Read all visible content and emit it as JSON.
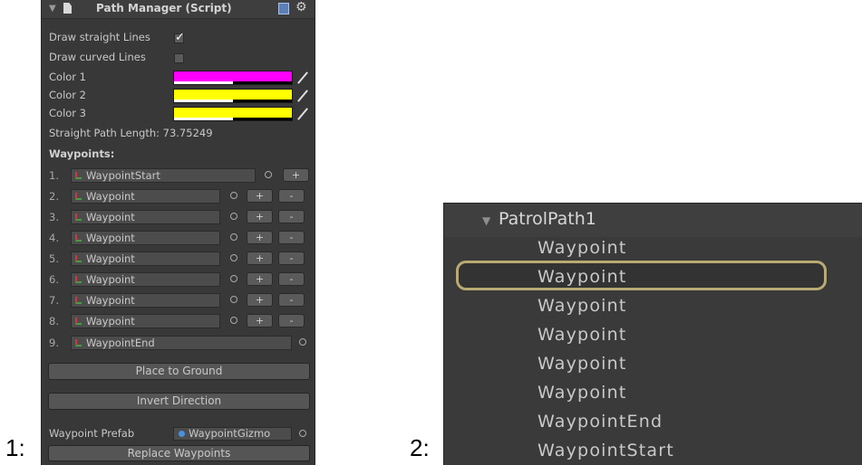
{
  "figure_labels": [
    "1:",
    "2:"
  ],
  "inspector": {
    "header_title": "Path Manager (Script)",
    "rows": {
      "draw_straight_label": "Draw straight Lines",
      "draw_straight_checked": true,
      "draw_curved_label": "Draw curved Lines",
      "draw_curved_checked": false,
      "color1_label": "Color 1",
      "color2_label": "Color 2",
      "color3_label": "Color 3",
      "length_text": "Straight Path Length: 73.75249",
      "waypoints_header": "Waypoints:"
    },
    "colors": {
      "color1": "#ff00ff",
      "color2": "#ffff00",
      "color3": "#ffff00",
      "color_alpha_fraction": 0.5
    },
    "waypoints": [
      {
        "index": "1.",
        "name": "WaypointStart",
        "add": "+"
      },
      {
        "index": "2.",
        "name": "Waypoint",
        "add": "+",
        "remove": "-"
      },
      {
        "index": "3.",
        "name": "Waypoint",
        "add": "+",
        "remove": "-"
      },
      {
        "index": "4.",
        "name": "Waypoint",
        "add": "+",
        "remove": "-"
      },
      {
        "index": "5.",
        "name": "Waypoint",
        "add": "+",
        "remove": "-"
      },
      {
        "index": "6.",
        "name": "Waypoint",
        "add": "+",
        "remove": "-"
      },
      {
        "index": "7.",
        "name": "Waypoint",
        "add": "+",
        "remove": "-"
      },
      {
        "index": "8.",
        "name": "Waypoint",
        "add": "+",
        "remove": "-"
      },
      {
        "index": "9.",
        "name": "WaypointEnd"
      }
    ],
    "buttons": {
      "place_to_ground": "Place to Ground",
      "invert_direction": "Invert Direction",
      "replace_waypoints": "Replace Waypoints"
    },
    "prefab_label": "Waypoint Prefab",
    "prefab_value": "WaypointGizmo",
    "icons": [
      "document-icon",
      "help-book-icon",
      "gear-icon",
      "transform-icon",
      "object-picker-icon",
      "color-picker-icon"
    ]
  },
  "hierarchy": {
    "parent": "PatrolPath1",
    "children": [
      "Waypoint",
      "Waypoint",
      "Waypoint",
      "Waypoint",
      "Waypoint",
      "Waypoint",
      "WaypointEnd",
      "WaypointStart"
    ],
    "selected_index": 1,
    "highlight_color": "#b8aa72"
  }
}
